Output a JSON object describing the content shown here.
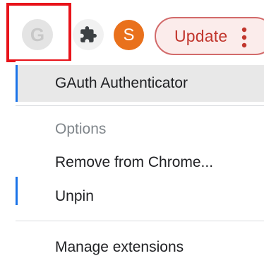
{
  "toolbar": {
    "extension_letter": "G",
    "avatar_letter": "S",
    "update_label": "Update",
    "colors": {
      "highlight": "#e8131a",
      "avatar": "#e9711c",
      "update_text": "#c1362d"
    }
  },
  "menu": {
    "items": [
      {
        "label": "GAuth Authenticator",
        "state": "hovered"
      },
      {
        "label": "Options",
        "state": "disabled"
      },
      {
        "label": "Remove from Chrome...",
        "state": "normal"
      },
      {
        "label": "Unpin",
        "state": "normal"
      },
      {
        "label": "Manage extensions",
        "state": "normal"
      }
    ]
  },
  "icons": [
    "google-extension-icon",
    "puzzle-icon",
    "kebab-menu-icon"
  ]
}
